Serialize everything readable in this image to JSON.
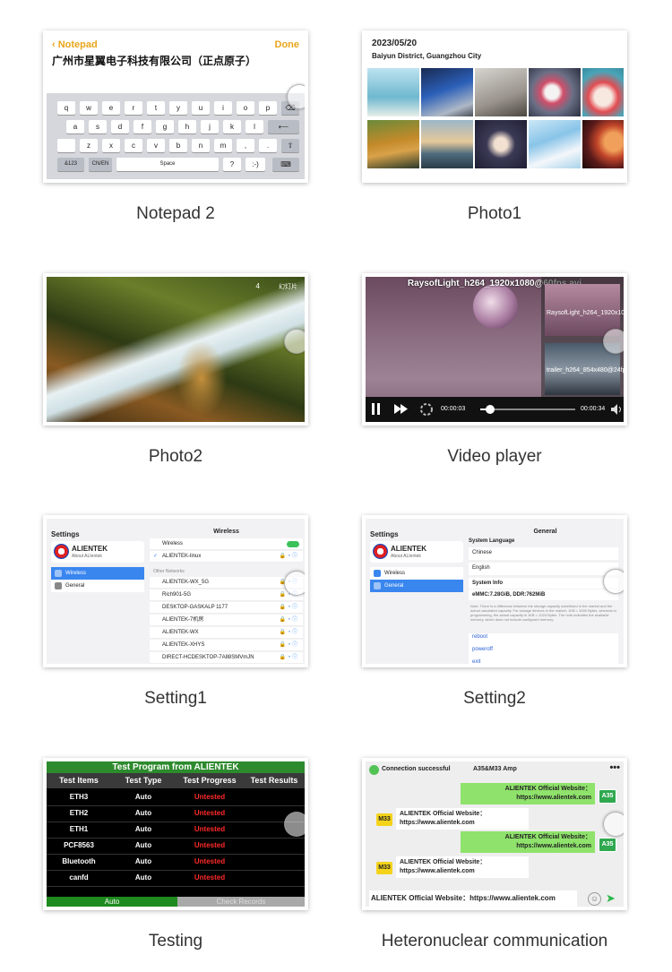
{
  "captions": {
    "notepad": "Notepad 2",
    "photo1": "Photo1",
    "photo2": "Photo2",
    "video": "Video player",
    "setting1": "Setting1",
    "setting2": "Setting2",
    "testing": "Testing",
    "hetero": "Heteronuclear communication"
  },
  "notepad": {
    "back": "Notepad",
    "done": "Done",
    "text": "广州市星翼电子科技有限公司（正点原子）",
    "rows": [
      [
        "q",
        "w",
        "e",
        "r",
        "t",
        "y",
        "u",
        "i",
        "o",
        "p",
        "⌫"
      ],
      [
        "a",
        "s",
        "d",
        "f",
        "g",
        "h",
        "j",
        "k",
        "l",
        "⟵"
      ],
      [
        "",
        "z",
        "x",
        "c",
        "v",
        "b",
        "n",
        "m",
        ",",
        ".",
        "⇧"
      ],
      [
        "&123",
        "CN/EN",
        "Space",
        "?",
        ":-)",
        "⌨"
      ]
    ]
  },
  "photo1": {
    "date": "2023/05/20",
    "location": "Baiyun District, Guangzhou City"
  },
  "photo2": {
    "index": "4",
    "open_label": "幻灯片"
  },
  "video": {
    "title": "RaysofLight_h264_1920x1080@60fps.avi",
    "playlist": [
      "RaysofLight_h264_1920x1080@60fps.avi",
      "trailer_h264_854x480@24fps.mp4"
    ],
    "current_time": "00:00:03",
    "total_time": "00:00:34",
    "progress": 0.1
  },
  "setting1": {
    "title": "Settings",
    "brand": "ALIENTEK",
    "about": "About ALIentek",
    "nav": [
      "Wireless",
      "General"
    ],
    "header": "Wireless",
    "wireless_label": "Wireless",
    "connected": "ALIENTEK-linux",
    "other_label": "Other Networks",
    "networks": [
      "ALIENTEK-WX_5G",
      "Rich901-5G",
      "DESKTOP-GASKALP 1177",
      "ALIENTEK-7机房",
      "ALIENTEK-WX",
      "ALIENTEK-XHYS",
      "DIRECT-HCDESKTOP-7A88SMVmJN"
    ]
  },
  "setting2": {
    "title": "Settings",
    "brand": "ALIENTEK",
    "about": "About ALIentek",
    "nav": [
      "Wireless",
      "General"
    ],
    "header": "General",
    "lang_label": "System Language",
    "languages": [
      "Chinese",
      "English"
    ],
    "info_label": "System Info",
    "info": "eMMC:7.28GiB, DDR:762MiB",
    "note": "Note: There is a difference between the storage capacity advertised in the market and the actual calculated capacity. For storage devices in the market, 1KB = 1000 Bytes, whereas in programming, the actual capacity is 1KB = 1024 Bytes. The note indicates the available memory, which does not include configured memory.",
    "actions": [
      "reboot",
      "poweroff",
      "exit"
    ]
  },
  "testing": {
    "title": "Test Program from ALIENTEK",
    "headers": [
      "Test Items",
      "Test Type",
      "Test Progress",
      "Test Results"
    ],
    "rows": [
      [
        "ETH3",
        "Auto",
        "Untested"
      ],
      [
        "ETH2",
        "Auto",
        "Untested"
      ],
      [
        "ETH1",
        "Auto",
        "Untested"
      ],
      [
        "PCF8563",
        "Auto",
        "Untested"
      ],
      [
        "Bluetooth",
        "Auto",
        "Untested"
      ],
      [
        "canfd",
        "Auto",
        "Untested"
      ]
    ],
    "auto": "Auto",
    "check": "Check Records"
  },
  "chat": {
    "status": "Connection successful",
    "title": "A35&M33 Amp",
    "more": "•••",
    "msg_right": "ALIENTEK Official Website：https://www.alientek.com",
    "msg_left": "ALIENTEK Official Website：https://www.alientek.com",
    "avatar_a35": "A35",
    "avatar_m33": "M33",
    "input": "ALIENTEK Official Website：https://www.alientek.com"
  },
  "colors": {
    "accent_orange": "#e9a51b",
    "settings_blue": "#3a86ef",
    "test_green": "#2d8a2d",
    "untested_red": "#ff2a2a",
    "chat_green": "#8fe26b"
  }
}
